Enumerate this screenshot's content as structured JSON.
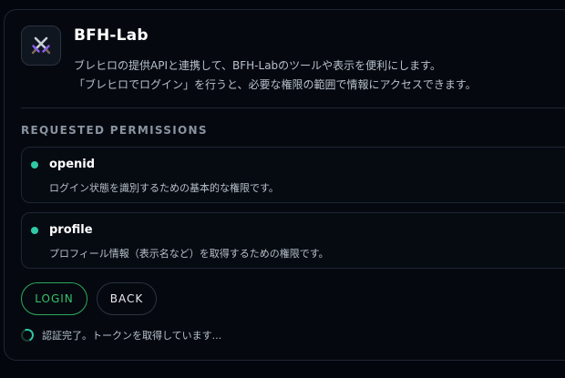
{
  "app": {
    "title": "BFH-Lab",
    "icon": "crossed-swords-icon",
    "description_line1": "ブレヒロの提供APIと連携して、BFH-Labのツールや表示を便利にします。",
    "description_line2": "「ブレヒロでログイン」を行うと、必要な権限の範囲で情報にアクセスできます。"
  },
  "permissions": {
    "section_label": "REQUESTED PERMISSIONS",
    "items": [
      {
        "name": "openid",
        "description": "ログイン状態を識別するための基本的な権限です。"
      },
      {
        "name": "profile",
        "description": "プロフィール情報（表示名など）を取得するための権限です。"
      }
    ]
  },
  "actions": {
    "login_label": "LOGIN",
    "back_label": "BACK"
  },
  "status": {
    "text": "認証完了。トークンを取得しています..."
  },
  "colors": {
    "accent_green": "#35c26a",
    "dot_teal": "#2fc9a5",
    "background": "#05090f"
  }
}
